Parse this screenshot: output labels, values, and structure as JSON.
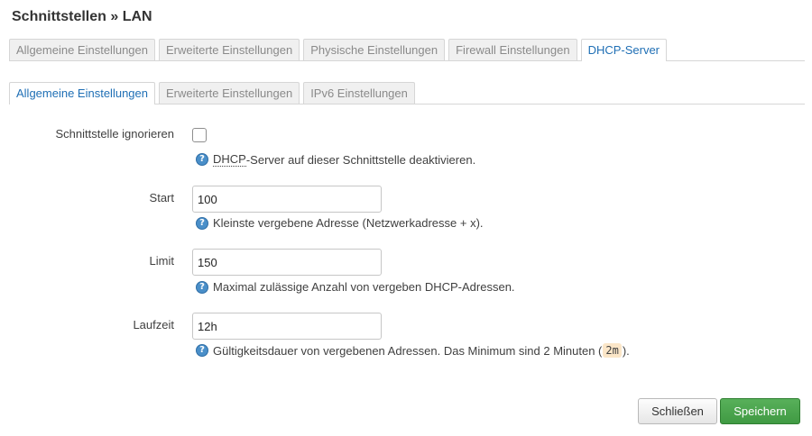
{
  "dialog": {
    "title": "Schnittstellen » LAN"
  },
  "main_tabs": [
    {
      "label": "Allgemeine Einstellungen",
      "active": false
    },
    {
      "label": "Erweiterte Einstellungen",
      "active": false
    },
    {
      "label": "Physische Einstellungen",
      "active": false
    },
    {
      "label": "Firewall Einstellungen",
      "active": false
    },
    {
      "label": "DHCP-Server",
      "active": true
    }
  ],
  "sub_tabs": [
    {
      "label": "Allgemeine Einstellungen",
      "active": true
    },
    {
      "label": "Erweiterte Einstellungen",
      "active": false
    },
    {
      "label": "IPv6 Einstellungen",
      "active": false
    }
  ],
  "form": {
    "ignore": {
      "label": "Schnittstelle ignorieren",
      "checked": false,
      "hint_abbr": "DHCP",
      "hint_rest": "-Server auf dieser Schnittstelle deaktivieren."
    },
    "start": {
      "label": "Start",
      "value": "100",
      "hint": "Kleinste vergebene Adresse (Netzwerkadresse + x)."
    },
    "limit": {
      "label": "Limit",
      "value": "150",
      "hint": "Maximal zulässige Anzahl von vergeben DHCP-Adressen."
    },
    "leasetime": {
      "label": "Laufzeit",
      "value": "12h",
      "hint_before": "Gültigkeitsdauer von vergebenen Adressen. Das Minimum sind 2 Minuten (",
      "hint_code": "2m",
      "hint_after": ")."
    }
  },
  "help_icon_glyph": "?",
  "buttons": {
    "close": "Schließen",
    "save": "Speichern"
  },
  "colors": {
    "accent": "#1f6fb5",
    "save": "#409a43"
  }
}
